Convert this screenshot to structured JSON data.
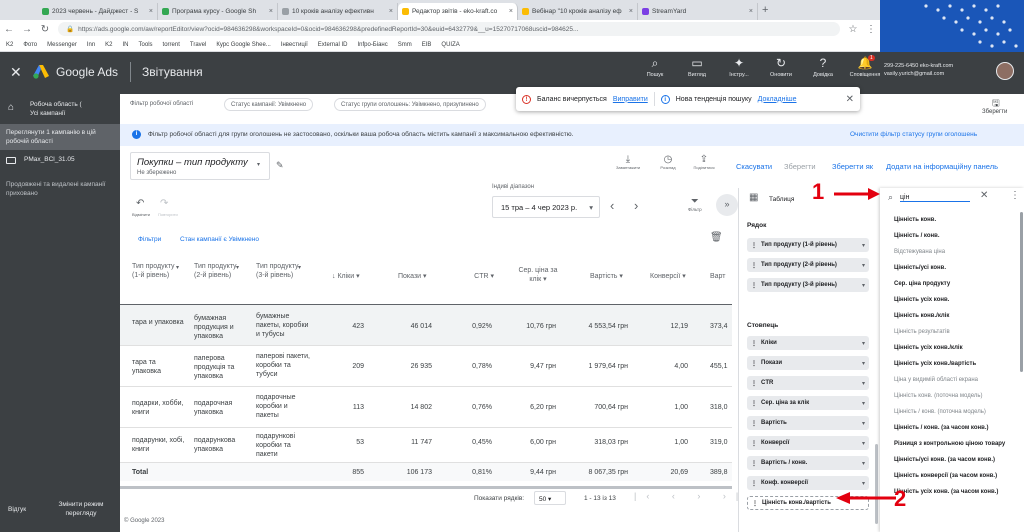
{
  "browser": {
    "tabs": [
      {
        "title": "2023 червень - Дайджест - S",
        "color": "#34a853"
      },
      {
        "title": "Програма курсу - Google Sh",
        "color": "#34a853"
      },
      {
        "title": "10 кроків аналізу ефективн",
        "color": "#9aa0a6"
      },
      {
        "title": "Редактор звітів - eko-kraft.co",
        "color": "#fbbc04"
      },
      {
        "title": "Вебінар \"10 кроків аналізу еф",
        "color": "#fbbc04"
      },
      {
        "title": "StreamYard",
        "color": "#7b3fe4"
      }
    ],
    "url": "https://ads.google.com/aw/reportEditor/view?ocid=984636298&workspaceId=0&ocid=984636298&predefinedReportId=30&euid=6432779&__u=15270717068uscid=984625...",
    "bookmarks": [
      "K2",
      "Фото",
      "Messenger",
      "Inn",
      "K2",
      "IN",
      "Tools",
      "torrent",
      "Travel",
      "Курс Google Shee...",
      "Інвестиції",
      "External ID",
      "Infpo-Біанс",
      "Smm",
      "ЕІВ",
      "QUIZA"
    ]
  },
  "app": {
    "product": "Google Ads",
    "page_title": "Звітування",
    "top_actions": [
      {
        "label": "Пошук",
        "icon": "search-icon",
        "badge": ""
      },
      {
        "label": "Вигляд",
        "icon": "appearance-icon",
        "badge": ""
      },
      {
        "label": "Інстру...",
        "icon": "tools-icon",
        "badge": ""
      },
      {
        "label": "Оновити",
        "icon": "refresh-icon",
        "badge": ""
      },
      {
        "label": "Довідка",
        "icon": "help-icon",
        "badge": ""
      },
      {
        "label": "Сповіщення",
        "icon": "bell-icon",
        "badge": "1"
      }
    ],
    "account_id": "299-225-6450 eko-kraft.com",
    "account_email": "vasily.yurich@gmail.com"
  },
  "sidebar": {
    "workspace_title": "Робоча область (",
    "workspace_sub": "Усі кампанії",
    "items": [
      {
        "label": "Переглянути 1 кампанію в цій робочій області",
        "active": true
      },
      {
        "label": "PMax_BCl_31.05",
        "active": false
      },
      {
        "label": "Продовжені та видалені кампанії приховано",
        "active": false
      }
    ],
    "feedback": "Відгук",
    "switch_mode": "Змінити режим перегляду"
  },
  "filterbar": {
    "label": "Фільтр робочої області",
    "chips": [
      "Статус кампанії: Увімкнено",
      "Статус групи оголошень: Увімкнено, призупинено"
    ],
    "save_label": "Зберегти"
  },
  "alerts": {
    "balance_text": "Баланс вичерпується",
    "balance_action": "Виправити",
    "trend_text": "Нова тенденція пошуку",
    "trend_action": "Докладніше"
  },
  "info_banner": {
    "text": "Фільтр робочої області для групи оголошень не застосовано, оскільки ваша робоча область містить кампанії з максимальною ефективністю.",
    "action": "Очистити фільтр статусу групи оголошень"
  },
  "report": {
    "title": "Покупки – тип продукту",
    "status": "Не збережено",
    "toolbar": [
      "Завантажити",
      "Розклад",
      "Поділитися"
    ],
    "cancel": "Скасувати",
    "save": "Зберегти",
    "save_as": "Зберегти як",
    "add_to_dashboard": "Додати на інформаційну панель",
    "undo_label": "Відмінити",
    "redo_label": "Повторити",
    "date_label": "Індиві діапазон",
    "date_value": "15 тра – 4 чер 2023 р.",
    "filter_label": "Фільтр",
    "filter_link": "Фільтри",
    "filter_chip": "Стан кампанії є Увімкнено"
  },
  "table": {
    "headers": [
      "Тип продукту (1-й рівень)",
      "Тип продукту (2-й рівень)",
      "Тип продукту (3-й рівень)",
      "Кліки",
      "Покази",
      "CTR",
      "Сер. ціна за клік",
      "Вартість",
      "Конверсії",
      "Варт"
    ],
    "rows": [
      [
        "тара и упаковка",
        "бумажная продукция и упаковка",
        "бумажные пакеты, коробки и тубусы",
        "423",
        "46 014",
        "0,92%",
        "10,76 грн",
        "4 553,54 грн",
        "12,19",
        "373,4"
      ],
      [
        "тара та упаковка",
        "паперова продукція та упаковка",
        "паперові пакети, коробки та тубуси",
        "209",
        "26 935",
        "0,78%",
        "9,47 грн",
        "1 979,64 грн",
        "4,00",
        "455,1"
      ],
      [
        "подарки, хобби, книги",
        "подарочная упаковка",
        "подарочные коробки и пакеты",
        "113",
        "14 802",
        "0,76%",
        "6,20 грн",
        "700,64 грн",
        "1,00",
        "318,0"
      ],
      [
        "подарунки, хобі, книги",
        "подарункова упаковка",
        "подарункові коробки та пакети",
        "53",
        "11 747",
        "0,45%",
        "6,00 грн",
        "318,03 грн",
        "1,00",
        "319,0"
      ]
    ],
    "total": [
      "Total",
      "",
      "",
      "855",
      "106 173",
      "0,81%",
      "9,44 грн",
      "8 067,35 грн",
      "20,69",
      "389,8"
    ],
    "rows_label": "Показати рядків:",
    "rows_value": "50",
    "range": "1 - 13 із 13",
    "copyright": "© Google 2023"
  },
  "panel": {
    "table_label": "Таблиця",
    "rows_label": "Рядок",
    "row_pills": [
      "Тип продукту (1-й рівень)",
      "Тип продукту (2-й рівень)",
      "Тип продукту (3-й рівень)"
    ],
    "cols_label": "Стовпець",
    "col_pills": [
      "Кліки",
      "Покази",
      "CTR",
      "Сер. ціна за клік",
      "Вартість",
      "Конверсії",
      "Вартість / конв.",
      "Конф. конверсії",
      "Цінність конв./вартість"
    ]
  },
  "search": {
    "query": "цін",
    "results": [
      {
        "text": "Цінність конв.",
        "dim": false
      },
      {
        "text": "Цінність / конв.",
        "dim": false
      },
      {
        "text": "Відстежувана ціна",
        "dim": true
      },
      {
        "text": "Цінність/усі конв.",
        "dim": false
      },
      {
        "text": "Сер. ціна продукту",
        "dim": false
      },
      {
        "text": "Цінність усіх конв.",
        "dim": false
      },
      {
        "text": "Цінність конв./клік",
        "dim": false
      },
      {
        "text": "Цінність результатів",
        "dim": true
      },
      {
        "text": "Цінність усіх конв./клік",
        "dim": false
      },
      {
        "text": "Цінність усіх конв./вартість",
        "dim": false
      },
      {
        "text": "Ціна у видимій області екрана",
        "dim": true
      },
      {
        "text": "Цінність конв. (поточна модель)",
        "dim": true
      },
      {
        "text": "Цінність / конв. (поточна модель)",
        "dim": true
      },
      {
        "text": "Цінність / конв. (за часом конв.)",
        "dim": false
      },
      {
        "text": "Різниця з контрольною ціною товару",
        "dim": false
      },
      {
        "text": "Цінність/усі конв. (за часом конв.)",
        "dim": false
      },
      {
        "text": "Цінність конверсії (за часом конв.)",
        "dim": false
      },
      {
        "text": "Цінність усіх конв. (за часом конв.)",
        "dim": false
      }
    ]
  },
  "annotations": [
    {
      "label": "1",
      "color": "#e3000f"
    },
    {
      "label": "2",
      "color": "#e3000f"
    }
  ],
  "colors": {
    "accent": "#1a73e8",
    "dark": "#3c4043",
    "annotation": "#e3000f"
  }
}
